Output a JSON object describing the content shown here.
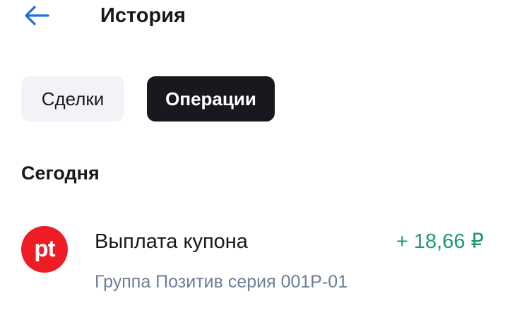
{
  "header": {
    "title": "История",
    "back_icon": "arrow-left-icon"
  },
  "tabs": [
    {
      "label": "Сделки",
      "active": false
    },
    {
      "label": "Операции",
      "active": true
    }
  ],
  "sections": [
    {
      "title": "Сегодня",
      "items": [
        {
          "logo_icon": "positive-group-logo-icon",
          "logo_text": "pt",
          "title": "Выплата купона",
          "amount": "+ 18,66 ₽",
          "subtitle": "Группа Позитив серия 001P-01"
        }
      ]
    }
  ],
  "colors": {
    "primary_text": "#17191e",
    "accent_blue": "#1f6fd6",
    "tab_inactive_bg": "#f1f3f7",
    "tab_active_bg": "#17191e",
    "positive_amount": "#1e9a6a",
    "secondary_text": "#6b7f98",
    "logo_red": "#ee1c24"
  }
}
